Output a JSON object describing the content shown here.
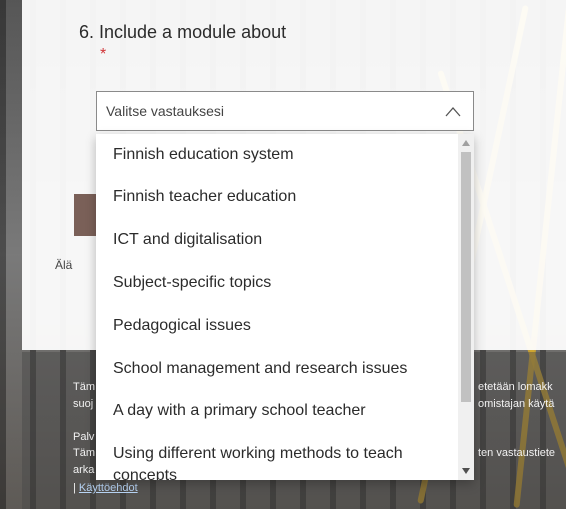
{
  "question": {
    "number_title": "6. Include a module about",
    "required_mark": "*"
  },
  "select": {
    "placeholder": "Valitse vastauksesi",
    "icon": "chevron-up-icon"
  },
  "options": [
    "Finnish education system",
    "Finnish teacher education",
    "ICT and digitalisation",
    "Subject-specific topics",
    "Pedagogical issues",
    "School management and research issues",
    "A day with a primary school teacher",
    "Using different working methods to teach concepts"
  ],
  "hint_partial": "Älä",
  "footer": {
    "line1_left": "Täm",
    "line1_right": "etetään lomakk",
    "line2_left": "suoj",
    "line2_right": "omistajan käytä",
    "line3_left": "Palv",
    "line4_left": "Täm",
    "line4_right": "ten vastaustiete",
    "line5_left": "arka",
    "link_prefix": "| ",
    "link_label": "Käyttöehdot"
  },
  "colors": {
    "required": "#d13438",
    "submit_button": "#7a6058",
    "link": "#b8d4f5"
  }
}
